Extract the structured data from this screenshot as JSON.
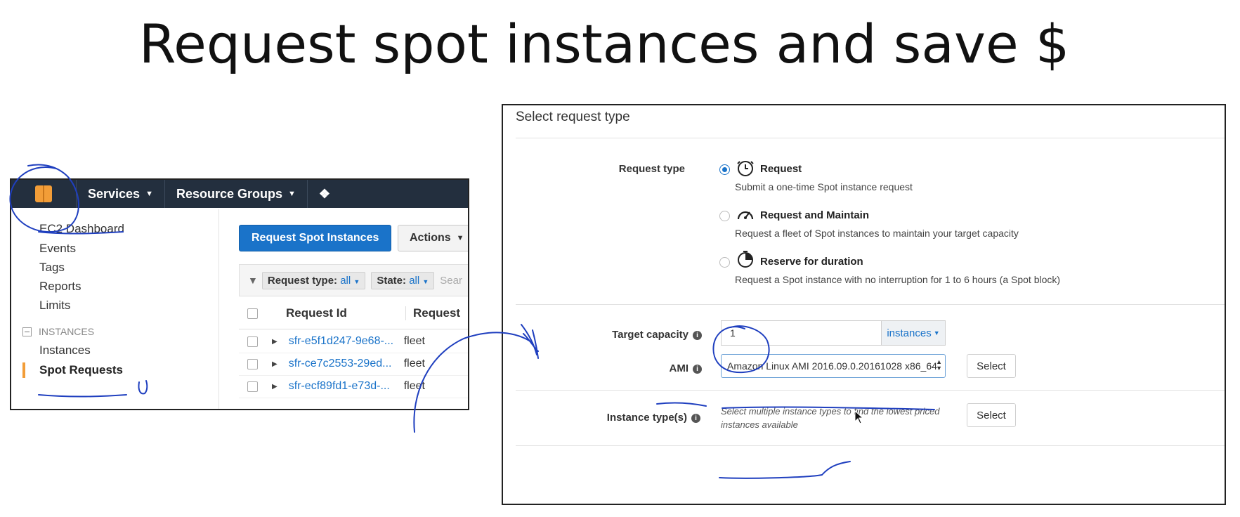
{
  "slide": {
    "title": "Request spot instances and save $"
  },
  "console": {
    "topbar": {
      "services_label": "Services",
      "resource_groups_label": "Resource Groups"
    },
    "sidebar": {
      "items": [
        "EC2 Dashboard",
        "Events",
        "Tags",
        "Reports",
        "Limits"
      ],
      "group_label": "INSTANCES",
      "group_items": [
        "Instances",
        "Spot Requests"
      ]
    },
    "toolbar": {
      "primary_label": "Request Spot Instances",
      "actions_label": "Actions"
    },
    "filters": {
      "type_label": "Request type:",
      "type_value": "all",
      "state_label": "State:",
      "state_value": "all",
      "search_placeholder": "Sear"
    },
    "table": {
      "headers": [
        "Request Id",
        "Request"
      ],
      "rows": [
        {
          "id": "sfr-e5f1d247-9e68-...",
          "type": "fleet"
        },
        {
          "id": "sfr-ce7c2553-29ed...",
          "type": "fleet"
        },
        {
          "id": "sfr-ecf89fd1-e73d-...",
          "type": "fleet"
        }
      ]
    }
  },
  "form": {
    "section_title": "Select request type",
    "request_type_label": "Request type",
    "options": [
      {
        "label": "Request",
        "desc": "Submit a one-time Spot instance request",
        "selected": true,
        "icon": "clock-icon"
      },
      {
        "label": "Request and Maintain",
        "desc": "Request a fleet of Spot instances to maintain your target capacity",
        "selected": false,
        "icon": "gauge-icon"
      },
      {
        "label": "Reserve for duration",
        "desc": "Request a Spot instance with no interruption for 1 to 6 hours (a Spot block)",
        "selected": false,
        "icon": "timer-icon"
      }
    ],
    "target_capacity_label": "Target capacity",
    "target_capacity_value": "1",
    "unit_label": "instances",
    "ami_label": "AMI",
    "ami_value": "Amazon Linux AMI 2016.09.0.20161028 x86_64",
    "select_label": "Select",
    "instance_types_label": "Instance type(s)",
    "instance_types_hint": "Select multiple instance types to find the lowest priced instances available"
  },
  "colors": {
    "aws_nav": "#232f3e",
    "aws_orange": "#f29d38",
    "primary_blue": "#1a73c9",
    "ink": "#1f3fbf"
  }
}
